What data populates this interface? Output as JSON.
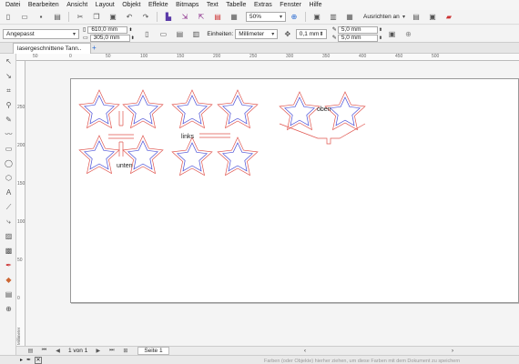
{
  "menu": [
    "Datei",
    "Bearbeiten",
    "Ansicht",
    "Layout",
    "Objekt",
    "Effekte",
    "Bitmaps",
    "Text",
    "Tabelle",
    "Extras",
    "Fenster",
    "Hilfe"
  ],
  "std_toolbar": {
    "zoom_value": "50%",
    "align_label": "Ausrichten an"
  },
  "prop_toolbar": {
    "page_preset": "Angepasst",
    "width": "610,0 mm",
    "height": "305,0 mm",
    "units_label": "Einheiten:",
    "units_value": "Millimeter",
    "nudge": "0,1 mm",
    "dup_x": "5,0 mm",
    "dup_y": "5,0 mm"
  },
  "tab": {
    "title": "lasergeschnittene Tann..",
    "add_symbol": "+"
  },
  "ruler": {
    "h_labels": [
      "50",
      "0",
      "50",
      "100",
      "150",
      "200",
      "250",
      "300",
      "350",
      "400",
      "450",
      "500"
    ],
    "v_labels": [
      "250",
      "200",
      "150",
      "100",
      "50",
      "0"
    ],
    "unit_label": "Millimeter"
  },
  "drawing": {
    "labels": [
      "unten",
      "links",
      "oben"
    ]
  },
  "page_nav": {
    "counter": "1 von 1",
    "page_tab": "Seite 1"
  },
  "status": {
    "hint": "Farben (oder Objekte) hierher ziehen, um diese Farben mit dem Dokument zu speichern"
  },
  "colors": {
    "outline_red": "#e0554f",
    "outline_blue": "#4a4fd6"
  }
}
